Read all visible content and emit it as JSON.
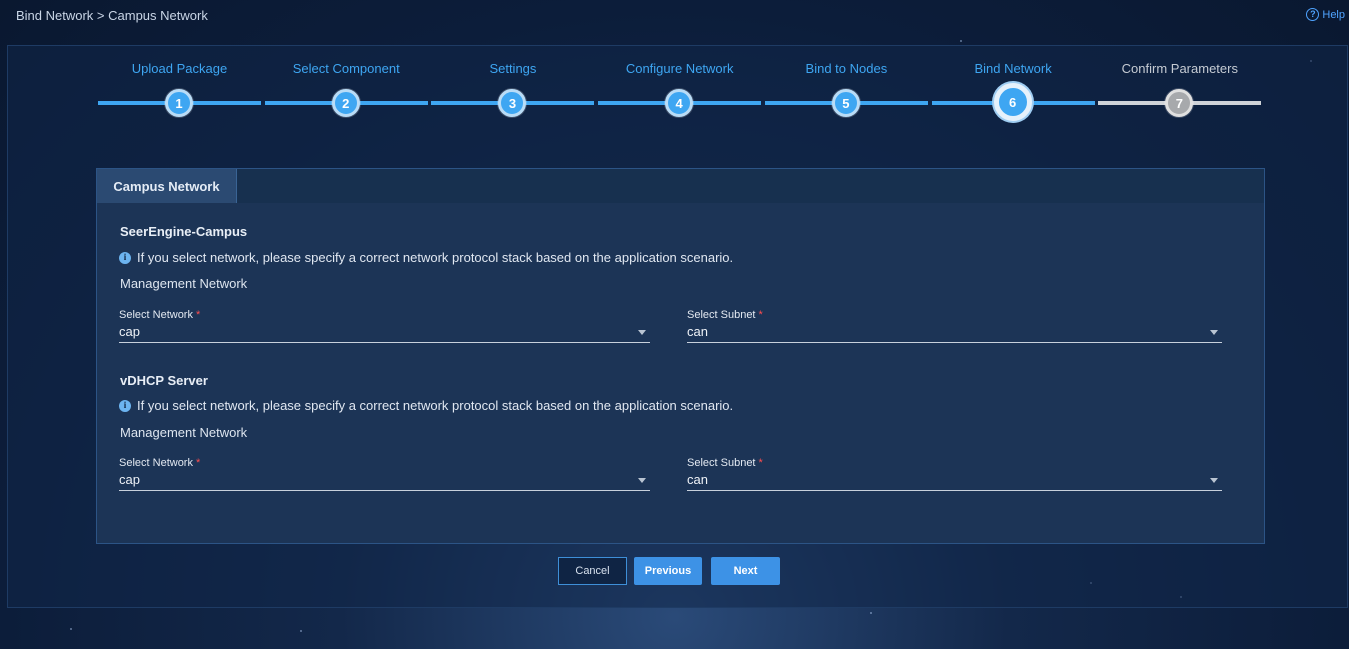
{
  "header": {
    "breadcrumb": "Bind Network > Campus Network",
    "help_label": "Help"
  },
  "steps": [
    {
      "label": "Upload Package",
      "number": "1",
      "state": "done"
    },
    {
      "label": "Select Component",
      "number": "2",
      "state": "done"
    },
    {
      "label": "Settings",
      "number": "3",
      "state": "done"
    },
    {
      "label": "Configure Network",
      "number": "4",
      "state": "done"
    },
    {
      "label": "Bind to Nodes",
      "number": "5",
      "state": "done"
    },
    {
      "label": "Bind Network",
      "number": "6",
      "state": "current"
    },
    {
      "label": "Confirm Parameters",
      "number": "7",
      "state": "pending"
    }
  ],
  "card": {
    "tab_label": "Campus Network",
    "sections": [
      {
        "title": "SeerEngine-Campus",
        "info": "If you select network, please specify a correct network protocol stack based on the application scenario.",
        "subheading": "Management Network",
        "network_label": "Select Network",
        "network_value": "cap",
        "subnet_label": "Select Subnet",
        "subnet_value": "can"
      },
      {
        "title": "vDHCP Server",
        "info": "If you select network, please specify a correct network protocol stack based on the application scenario.",
        "subheading": "Management Network",
        "network_label": "Select Network",
        "network_value": "cap",
        "subnet_label": "Select Subnet",
        "subnet_value": "can"
      }
    ],
    "required_mark": "*"
  },
  "actions": {
    "cancel_label": "Cancel",
    "previous_label": "Previous",
    "next_label": "Next"
  },
  "colors": {
    "accent": "#3ea6f2",
    "button": "#3d92e6",
    "pending": "#a7a9ac",
    "required": "#ff4d4f"
  }
}
